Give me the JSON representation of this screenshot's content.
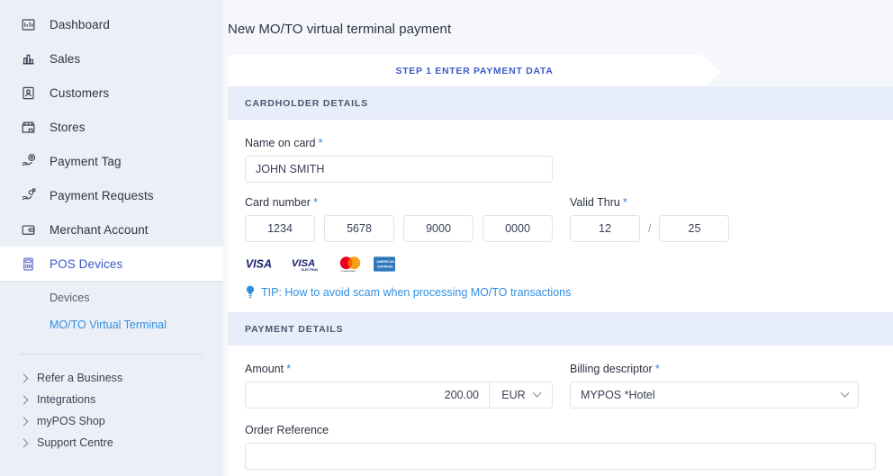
{
  "sidebar": {
    "items": [
      {
        "label": "Dashboard",
        "icon": "dashboard-icon",
        "active": false
      },
      {
        "label": "Sales",
        "icon": "bar-chart-icon",
        "active": false
      },
      {
        "label": "Customers",
        "icon": "customers-icon",
        "active": false
      },
      {
        "label": "Stores",
        "icon": "store-icon",
        "active": false
      },
      {
        "label": "Payment Tag",
        "icon": "payment-tag-icon",
        "active": false
      },
      {
        "label": "Payment Requests",
        "icon": "payment-requests-icon",
        "active": false
      },
      {
        "label": "Merchant Account",
        "icon": "wallet-icon",
        "active": false
      },
      {
        "label": "POS Devices",
        "icon": "pos-terminal-icon",
        "active": true
      }
    ],
    "subitems": [
      {
        "label": "Devices",
        "active": false
      },
      {
        "label": "MO/TO Virtual Terminal",
        "active": true
      }
    ],
    "collapsibles": [
      {
        "label": "Refer a Business"
      },
      {
        "label": "Integrations"
      },
      {
        "label": "myPOS Shop"
      },
      {
        "label": "Support Centre"
      }
    ],
    "colors": {
      "background": "#edeff7",
      "active_text": "#3a58c8",
      "sub_active_text": "#2f8fe0"
    }
  },
  "main": {
    "page_title": "New MO/TO virtual terminal payment",
    "step_tab": {
      "label": "STEP 1 ENTER PAYMENT DATA",
      "accent": "#3e5bc6"
    },
    "cardholder": {
      "section_title": "CARDHOLDER DETAILS",
      "name_label": "Name on card",
      "name_required": "*",
      "name_value": "JOHN SMITH",
      "card_number_label": "Card number",
      "card_number_required": "*",
      "card_segments": [
        "1234",
        "5678",
        "9000",
        "0000"
      ],
      "valid_thru_label": "Valid Thru",
      "valid_thru_required": "*",
      "valid_month": "12",
      "valid_separator": "/",
      "valid_year": "25",
      "brands": [
        "visa",
        "visa-electron",
        "mastercard",
        "american-express"
      ],
      "tip_text": "TIP: How to avoid scam when processing MO/TO transactions"
    },
    "payment": {
      "section_title": "PAYMENT DETAILS",
      "amount_label": "Amount",
      "amount_required": "*",
      "amount_value": "200.00",
      "currency_value": "EUR",
      "billing_label": "Billing descriptor",
      "billing_required": "*",
      "billing_value": "MYPOS *Hotel",
      "order_label": "Order Reference",
      "order_value": ""
    }
  }
}
